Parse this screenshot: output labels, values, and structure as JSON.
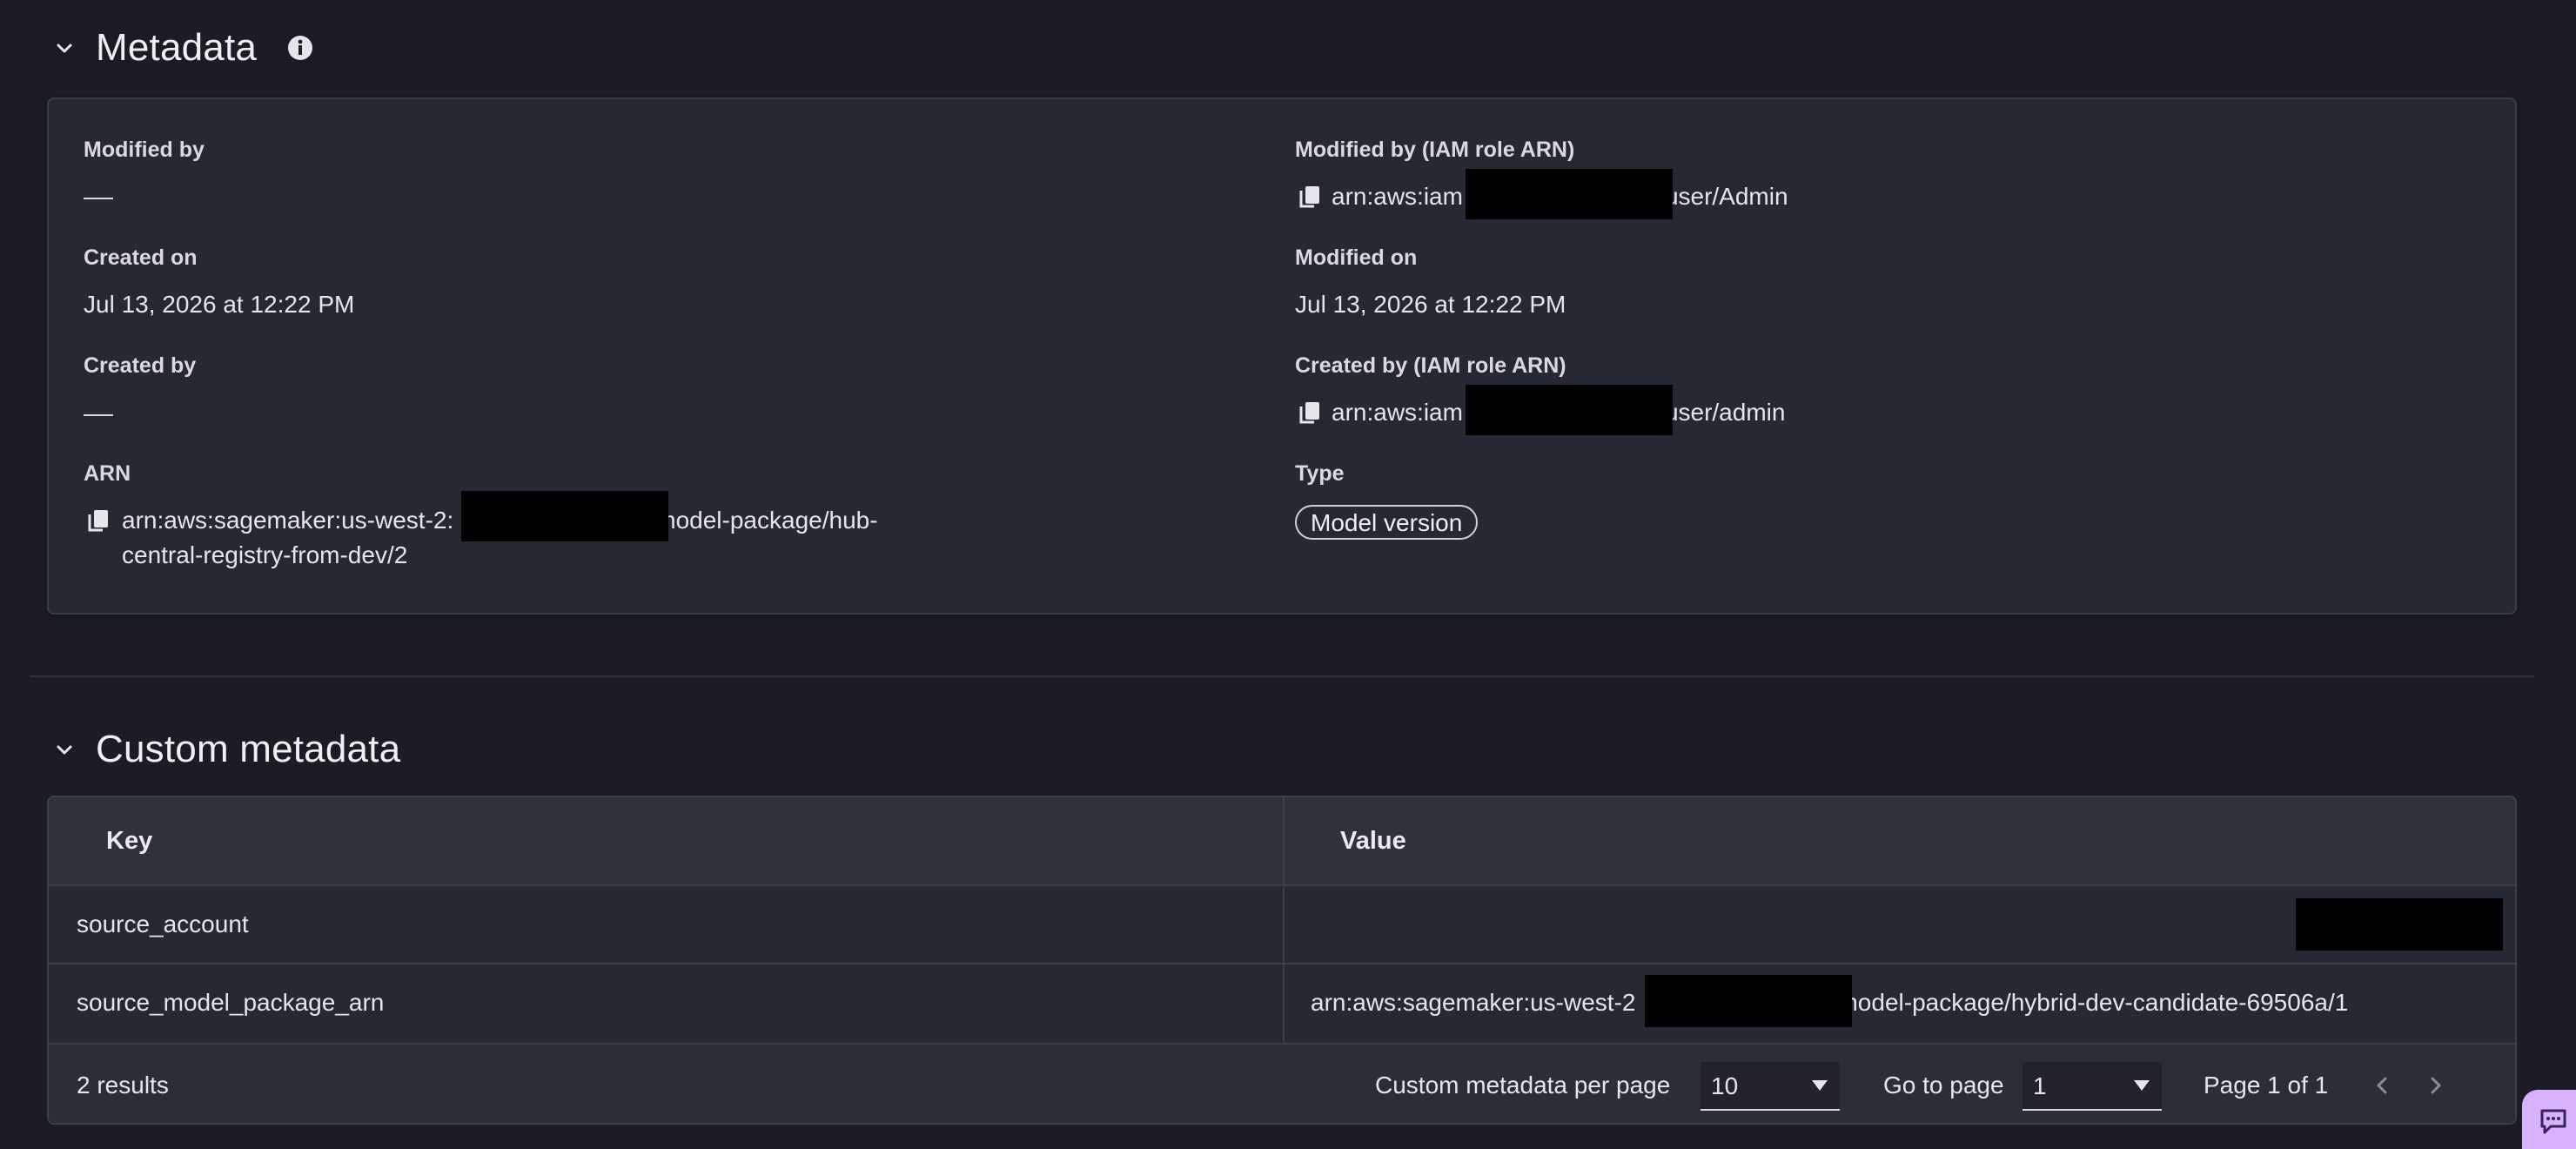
{
  "metadata_section": {
    "title": "Metadata",
    "fields": {
      "modified_by": {
        "label": "Modified by",
        "value": "—"
      },
      "modified_by_arn": {
        "label": "Modified by (IAM role ARN)",
        "value_prefix": "arn:aws:iam",
        "value_suffix": "user/Admin"
      },
      "created_on": {
        "label": "Created on",
        "value": "Jul 13, 2026 at 12:22 PM"
      },
      "modified_on": {
        "label": "Modified on",
        "value": "Jul 13, 2026 at 12:22 PM"
      },
      "created_by": {
        "label": "Created by",
        "value": "—"
      },
      "created_by_arn": {
        "label": "Created by (IAM role ARN)",
        "value_prefix": "arn:aws:iam",
        "value_suffix": "user/admin"
      },
      "arn": {
        "label": "ARN",
        "value_prefix": "arn:aws:sagemaker:us-west-2:",
        "value_suffix": "model-package/hub-",
        "value_line2": "central-registry-from-dev/2"
      },
      "type": {
        "label": "Type",
        "value": "Model version"
      }
    }
  },
  "custom_metadata_section": {
    "title": "Custom metadata",
    "table": {
      "columns": [
        "Key",
        "Value"
      ],
      "rows": [
        {
          "key": "source_account",
          "value": ""
        },
        {
          "key": "source_model_package_arn",
          "value_prefix": "arn:aws:sagemaker:us-west-2",
          "value_suffix": "model-package/hybrid-dev-candidate-69506a/1"
        }
      ]
    },
    "footer": {
      "results": "2 results",
      "per_page_label": "Custom metadata per page",
      "per_page_value": "10",
      "go_to_page_label": "Go to page",
      "go_to_page_value": "1",
      "page_status": "Page 1 of 1"
    }
  },
  "colors": {
    "background": "#1b1c26",
    "panel": "#262834",
    "chat_accent": "#d7b3ff"
  }
}
